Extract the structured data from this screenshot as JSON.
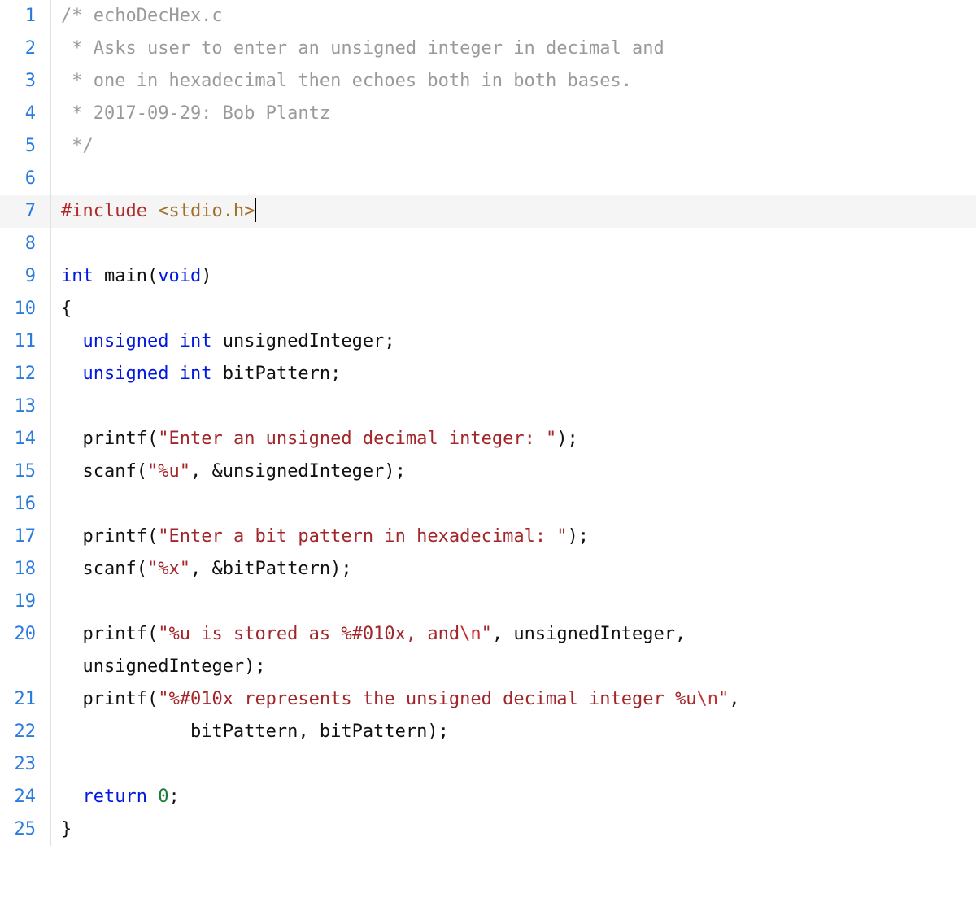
{
  "editor": {
    "active_line": 7,
    "cursor_after_line": 7,
    "lines": [
      {
        "n": 1,
        "tokens": [
          {
            "t": "/* echoDecHex.c",
            "c": "tk-comment"
          }
        ]
      },
      {
        "n": 2,
        "tokens": [
          {
            "t": " * Asks user to enter an unsigned integer in decimal and",
            "c": "tk-comment"
          }
        ]
      },
      {
        "n": 3,
        "tokens": [
          {
            "t": " * one in hexadecimal then echoes both in both bases.",
            "c": "tk-comment"
          }
        ]
      },
      {
        "n": 4,
        "tokens": [
          {
            "t": " * 2017-09-29: Bob Plantz",
            "c": "tk-comment"
          }
        ]
      },
      {
        "n": 5,
        "tokens": [
          {
            "t": " */",
            "c": "tk-comment"
          }
        ]
      },
      {
        "n": 6,
        "tokens": []
      },
      {
        "n": 7,
        "active": true,
        "cursor": true,
        "tokens": [
          {
            "t": "#include ",
            "c": "tk-pp"
          },
          {
            "t": "<stdio.h>",
            "c": "tk-ppinc"
          }
        ]
      },
      {
        "n": 8,
        "tokens": []
      },
      {
        "n": 9,
        "tokens": [
          {
            "t": "int",
            "c": "tk-keyword"
          },
          {
            "t": " ",
            "c": ""
          },
          {
            "t": "main",
            "c": "tk-func"
          },
          {
            "t": "(",
            "c": "tk-punct"
          },
          {
            "t": "void",
            "c": "tk-keyword"
          },
          {
            "t": ")",
            "c": "tk-punct"
          }
        ]
      },
      {
        "n": 10,
        "tokens": [
          {
            "t": "{",
            "c": "tk-punct"
          }
        ]
      },
      {
        "n": 11,
        "indent": 1,
        "tokens": [
          {
            "t": "  ",
            "c": ""
          },
          {
            "t": "unsigned",
            "c": "tk-keyword"
          },
          {
            "t": " ",
            "c": ""
          },
          {
            "t": "int",
            "c": "tk-keyword"
          },
          {
            "t": " ",
            "c": ""
          },
          {
            "t": "unsignedInteger",
            "c": "tk-ident"
          },
          {
            "t": ";",
            "c": "tk-punct"
          }
        ]
      },
      {
        "n": 12,
        "indent": 1,
        "tokens": [
          {
            "t": "  ",
            "c": ""
          },
          {
            "t": "unsigned",
            "c": "tk-keyword"
          },
          {
            "t": " ",
            "c": ""
          },
          {
            "t": "int",
            "c": "tk-keyword"
          },
          {
            "t": " ",
            "c": ""
          },
          {
            "t": "bitPattern",
            "c": "tk-ident"
          },
          {
            "t": ";",
            "c": "tk-punct"
          }
        ]
      },
      {
        "n": 13,
        "indent": 1,
        "tokens": []
      },
      {
        "n": 14,
        "indent": 1,
        "tokens": [
          {
            "t": "  ",
            "c": ""
          },
          {
            "t": "printf",
            "c": "tk-func"
          },
          {
            "t": "(",
            "c": "tk-punct"
          },
          {
            "t": "\"Enter an unsigned decimal integer: \"",
            "c": "tk-string"
          },
          {
            "t": ");",
            "c": "tk-punct"
          }
        ]
      },
      {
        "n": 15,
        "indent": 1,
        "tokens": [
          {
            "t": "  ",
            "c": ""
          },
          {
            "t": "scanf",
            "c": "tk-func"
          },
          {
            "t": "(",
            "c": "tk-punct"
          },
          {
            "t": "\"%u\"",
            "c": "tk-string"
          },
          {
            "t": ", &",
            "c": "tk-punct"
          },
          {
            "t": "unsignedInteger",
            "c": "tk-ident"
          },
          {
            "t": ");",
            "c": "tk-punct"
          }
        ]
      },
      {
        "n": 16,
        "indent": 1,
        "tokens": []
      },
      {
        "n": 17,
        "indent": 1,
        "tokens": [
          {
            "t": "  ",
            "c": ""
          },
          {
            "t": "printf",
            "c": "tk-func"
          },
          {
            "t": "(",
            "c": "tk-punct"
          },
          {
            "t": "\"Enter a bit pattern in hexadecimal: \"",
            "c": "tk-string"
          },
          {
            "t": ");",
            "c": "tk-punct"
          }
        ]
      },
      {
        "n": 18,
        "indent": 1,
        "tokens": [
          {
            "t": "  ",
            "c": ""
          },
          {
            "t": "scanf",
            "c": "tk-func"
          },
          {
            "t": "(",
            "c": "tk-punct"
          },
          {
            "t": "\"%x\"",
            "c": "tk-string"
          },
          {
            "t": ", &",
            "c": "tk-punct"
          },
          {
            "t": "bitPattern",
            "c": "tk-ident"
          },
          {
            "t": ");",
            "c": "tk-punct"
          }
        ]
      },
      {
        "n": 19,
        "indent": 1,
        "tokens": []
      },
      {
        "n": 20,
        "indent": 1,
        "tokens": [
          {
            "t": "  ",
            "c": ""
          },
          {
            "t": "printf",
            "c": "tk-func"
          },
          {
            "t": "(",
            "c": "tk-punct"
          },
          {
            "t": "\"%u is stored as %#010x, and",
            "c": "tk-string"
          },
          {
            "t": "\\n",
            "c": "tk-escape"
          },
          {
            "t": "\"",
            "c": "tk-string"
          },
          {
            "t": ", ",
            "c": "tk-punct"
          },
          {
            "t": "unsignedInteger",
            "c": "tk-ident"
          },
          {
            "t": ", ",
            "c": "tk-punct"
          }
        ],
        "wrap_tokens": [
          {
            "t": "  ",
            "c": ""
          },
          {
            "t": "unsignedInteger",
            "c": "tk-ident"
          },
          {
            "t": ");",
            "c": "tk-punct"
          }
        ]
      },
      {
        "n": 21,
        "indent": 1,
        "tokens": [
          {
            "t": "  ",
            "c": ""
          },
          {
            "t": "printf",
            "c": "tk-func"
          },
          {
            "t": "(",
            "c": "tk-punct"
          },
          {
            "t": "\"%#010x represents the unsigned decimal integer %u",
            "c": "tk-string"
          },
          {
            "t": "\\n",
            "c": "tk-escape"
          },
          {
            "t": "\"",
            "c": "tk-string"
          },
          {
            "t": ",",
            "c": "tk-punct"
          }
        ]
      },
      {
        "n": 22,
        "indent": 1,
        "guides": 5,
        "tokens": [
          {
            "t": "            ",
            "c": ""
          },
          {
            "t": "bitPattern",
            "c": "tk-ident"
          },
          {
            "t": ", ",
            "c": "tk-punct"
          },
          {
            "t": "bitPattern",
            "c": "tk-ident"
          },
          {
            "t": ");",
            "c": "tk-punct"
          }
        ]
      },
      {
        "n": 23,
        "indent": 1,
        "tokens": []
      },
      {
        "n": 24,
        "indent": 1,
        "tokens": [
          {
            "t": "  ",
            "c": ""
          },
          {
            "t": "return",
            "c": "tk-keyword"
          },
          {
            "t": " ",
            "c": ""
          },
          {
            "t": "0",
            "c": "tk-number"
          },
          {
            "t": ";",
            "c": "tk-punct"
          }
        ]
      },
      {
        "n": 25,
        "tokens": [
          {
            "t": "}",
            "c": "tk-punct"
          }
        ]
      }
    ]
  }
}
